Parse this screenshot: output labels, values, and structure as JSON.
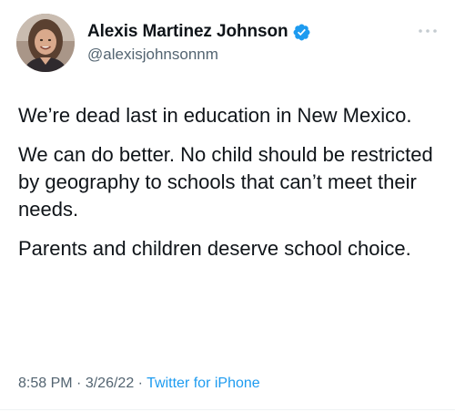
{
  "author": {
    "name": "Alexis Martinez Johnson",
    "handle": "@alexisjohnsonnm",
    "verified": true,
    "avatar_icon": "profile-photo"
  },
  "tweet": {
    "paragraphs": [
      "We’re dead last in education in New Mexico.",
      "We can do better. No child should be restricted by geography to schools that can’t meet their needs.",
      "Parents and children deserve school choice."
    ]
  },
  "meta": {
    "time": "8:58 PM",
    "separator": "·",
    "date": "3/26/22",
    "source": "Twitter for iPhone"
  },
  "colors": {
    "verified_badge": "#1d9bf0",
    "link": "#1d9bf0",
    "secondary_text": "#536471"
  },
  "icons": {
    "more": "more-dots-icon",
    "verified": "verified-badge-icon"
  }
}
